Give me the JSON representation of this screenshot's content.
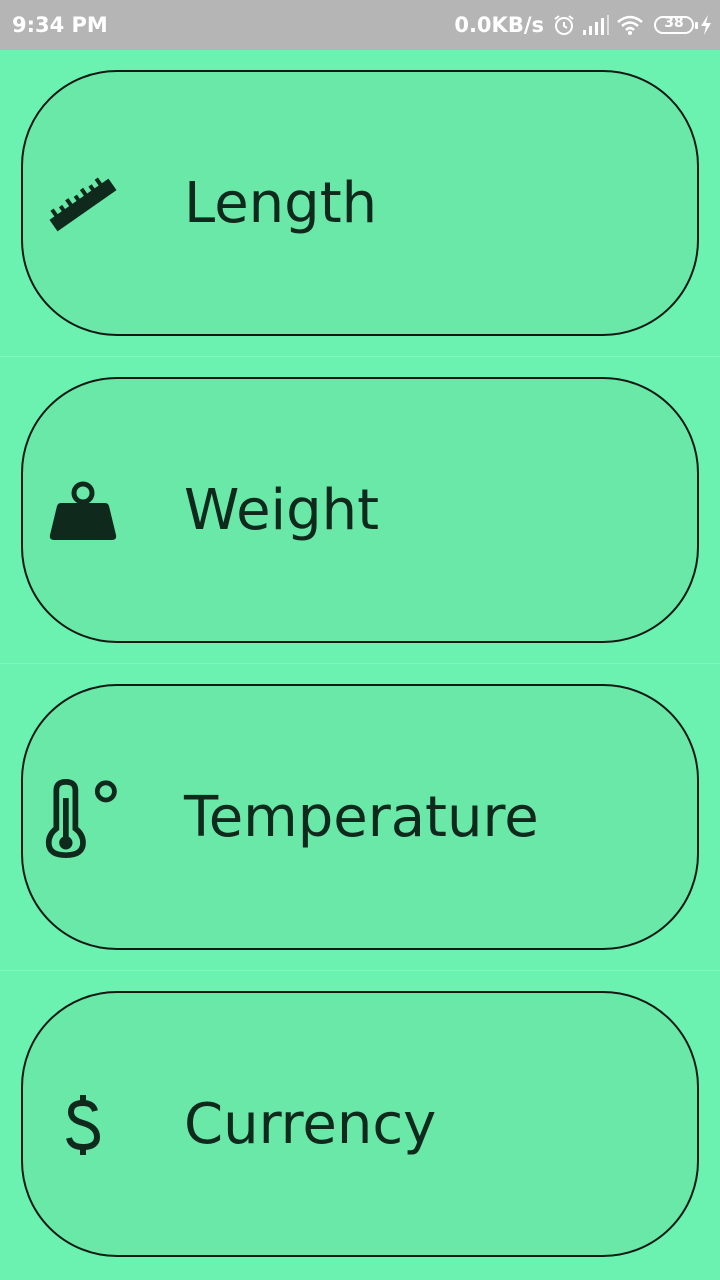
{
  "status_bar": {
    "time": "9:34 PM",
    "network_speed": "0.0KB/s",
    "battery_level": "38",
    "icons": [
      "alarm-icon",
      "signal-icon",
      "wifi-icon",
      "battery-icon",
      "charging-icon"
    ]
  },
  "categories": [
    {
      "label": "Length",
      "icon": "ruler-icon"
    },
    {
      "label": "Weight",
      "icon": "weight-icon"
    },
    {
      "label": "Temperature",
      "icon": "thermometer-icon"
    },
    {
      "label": "Currency",
      "icon": "dollar-icon"
    }
  ],
  "colors": {
    "background": "#6bf2b0",
    "card": "#69e8a8",
    "text": "#0f2a1c",
    "status_bar": "#b5b5b5"
  }
}
